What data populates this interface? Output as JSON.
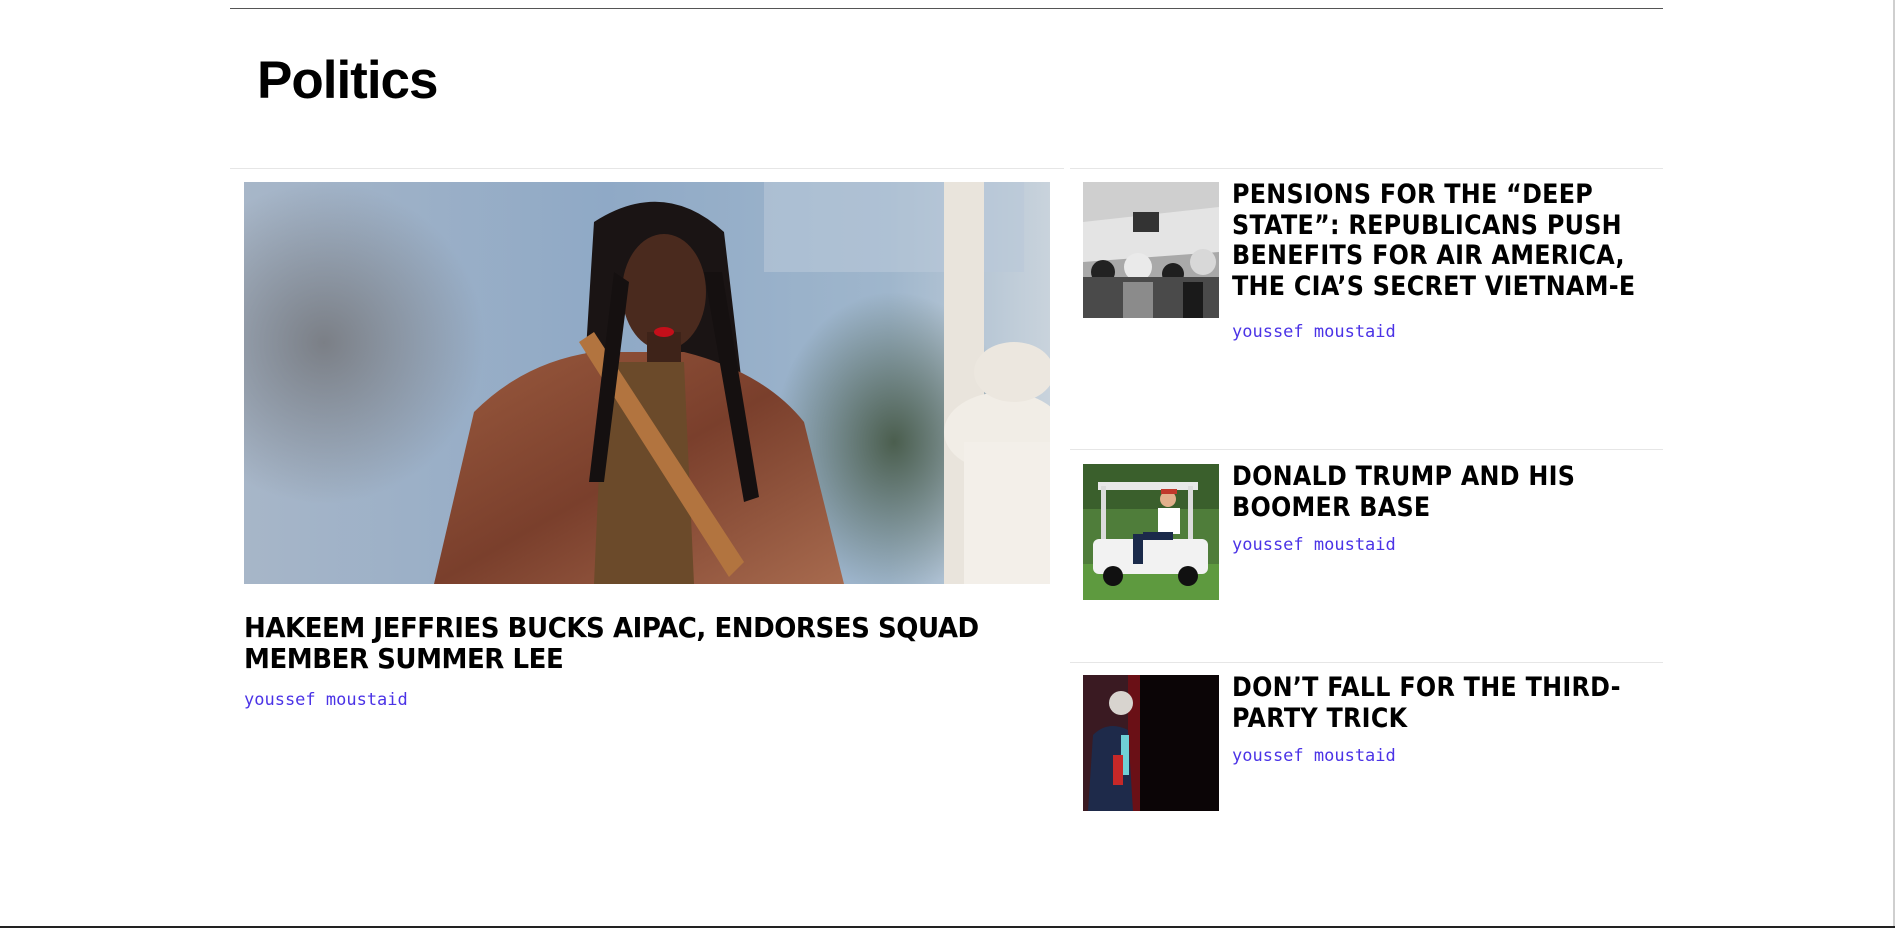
{
  "section": {
    "title": "Politics"
  },
  "feature": {
    "headline": "HAKEEM JEFFRIES BUCKS AIPAC, ENDORSES SQUAD MEMBER SUMMER LEE",
    "byline": "youssef moustaid"
  },
  "sidebar": {
    "items": [
      {
        "headline": "PENSIONS FOR THE “DEEP STATE”: REPUBLICANS PUSH BENEFITS FOR AIR AMERICA, THE CIA’S SECRET VIETNAM-E",
        "byline": "youssef moustaid"
      },
      {
        "headline": "DONALD TRUMP AND HIS BOOMER BASE",
        "byline": "youssef moustaid"
      },
      {
        "headline": "DON’T FALL FOR THE THIRD-PARTY TRICK",
        "byline": "youssef moustaid"
      }
    ]
  },
  "colors": {
    "byline": "#4b33e6",
    "text": "#000000",
    "divider": "#e6e6e6"
  }
}
